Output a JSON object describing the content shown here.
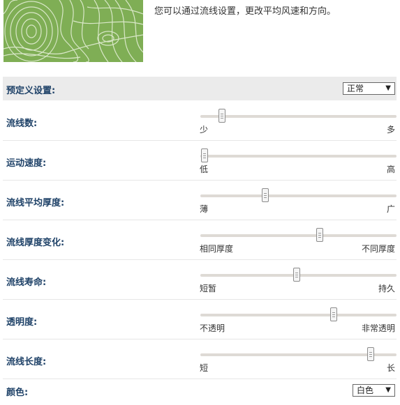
{
  "intro_text": "您可以通过流线设置，更改平均风速和方向。",
  "preview_colors": {
    "background": "#7fae55",
    "lines": "#e9f2dd"
  },
  "preset": {
    "label": "预定义设置:",
    "value": "正常"
  },
  "sliders": [
    {
      "label": "流线数:",
      "min_label": "少",
      "max_label": "多",
      "value": 0.11
    },
    {
      "label": "运动速度:",
      "min_label": "低",
      "max_label": "高",
      "value": 0.02
    },
    {
      "label": "流线平均厚度:",
      "min_label": "薄",
      "max_label": "广",
      "value": 0.33
    },
    {
      "label": "流线厚度变化:",
      "min_label": "相同厚度",
      "max_label": "不同厚度",
      "value": 0.61
    },
    {
      "label": "流线寿命:",
      "min_label": "短暂",
      "max_label": "持久",
      "value": 0.49
    },
    {
      "label": "透明度:",
      "min_label": "不透明",
      "max_label": "非常透明",
      "value": 0.68
    },
    {
      "label": "流线长度:",
      "min_label": "短",
      "max_label": "长",
      "value": 0.87
    }
  ],
  "color": {
    "label": "颜色:",
    "value": "白色"
  }
}
